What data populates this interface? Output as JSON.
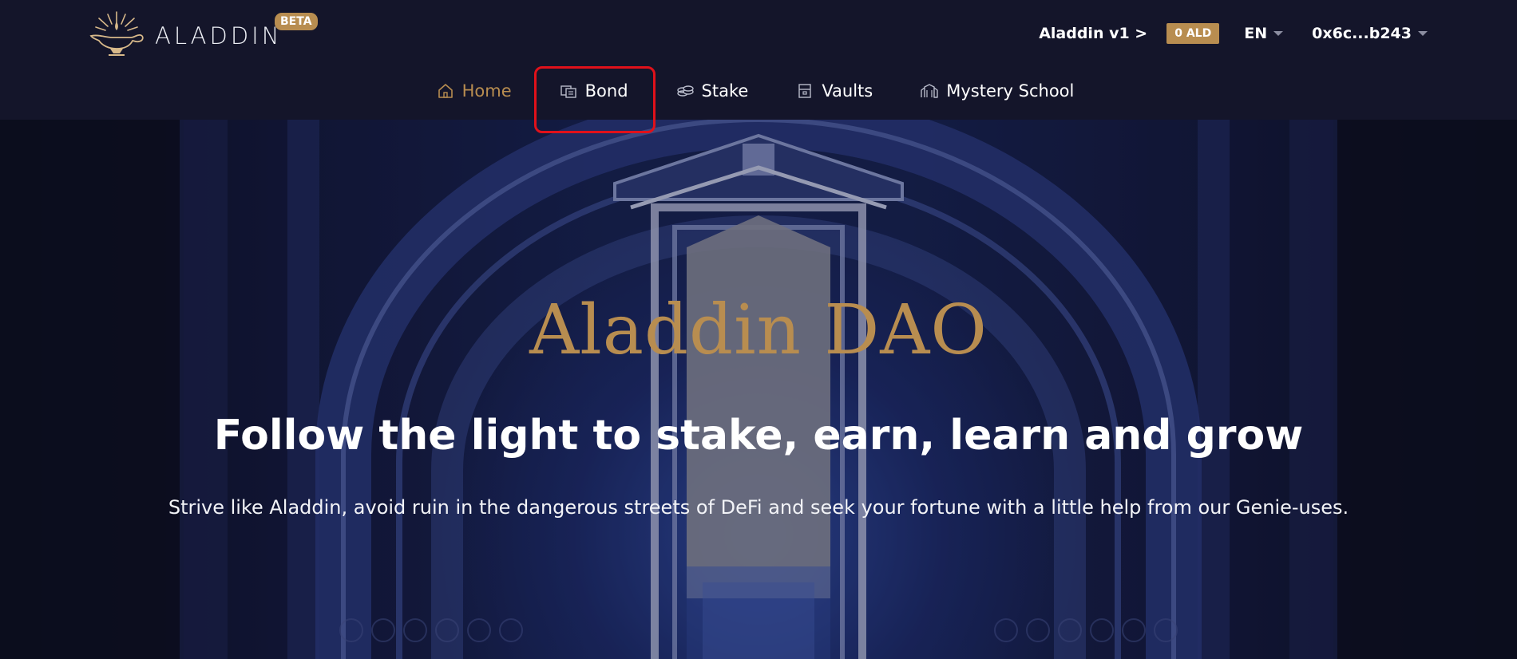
{
  "header": {
    "logo_text": "ALADDIN",
    "beta_badge": "BETA",
    "version_link": "Aladdin v1 >",
    "balance_badge": "0 ALD",
    "language": "EN",
    "wallet": "0x6c...b243"
  },
  "nav": {
    "items": [
      {
        "label": "Home",
        "icon": "home-icon",
        "active": true
      },
      {
        "label": "Bond",
        "icon": "bond-icon",
        "highlighted": true
      },
      {
        "label": "Stake",
        "icon": "coins-icon"
      },
      {
        "label": "Vaults",
        "icon": "vault-icon"
      },
      {
        "label": "Mystery School",
        "icon": "school-icon"
      }
    ]
  },
  "hero": {
    "title": "Aladdin DAO",
    "subtitle": "Follow the light to stake, earn, learn and grow",
    "description": "Strive like Aladdin, avoid ruin in the dangerous streets of DeFi and seek your fortune with a little help from our Genie-uses."
  },
  "colors": {
    "accent_gold": "#b88d50",
    "header_bg": "#14152a",
    "highlight_red": "#e0111a"
  }
}
